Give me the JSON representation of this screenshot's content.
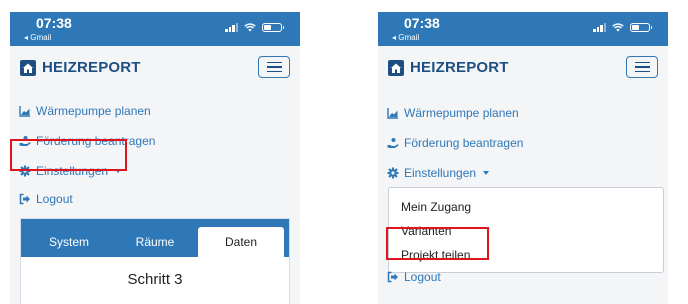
{
  "status_bar": {
    "time": "07:38",
    "back_app": "◂ Gmail"
  },
  "brand": {
    "name": "HEIZREPORT"
  },
  "nav": {
    "waermepumpe": "Wärmepumpe planen",
    "foerderung": "Förderung beantragen",
    "einstellungen": "Einstellungen",
    "logout": "Logout"
  },
  "dropdown": {
    "items": [
      "Mein Zugang",
      "Varianten",
      "Projekt teilen"
    ]
  },
  "tabs": [
    "System",
    "Räume",
    "Daten"
  ],
  "step_title": "Schritt 3",
  "colors": {
    "primary": "#2f78b8",
    "brand_dark": "#1e4e82",
    "highlight": "#e0141e"
  }
}
